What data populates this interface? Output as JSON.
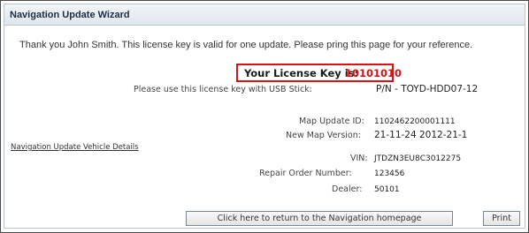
{
  "window": {
    "title": "Navigation Update Wizard"
  },
  "message": "Thank you John Smith.  This license key is valid for one update.  Please pring this page for your reference.",
  "license": {
    "label": "Your License Key is:",
    "key": "10101010",
    "usb_label": "Please use this license key with USB Stick:",
    "usb_value": "P/N - TOYD-HDD07-12"
  },
  "map": {
    "update_id_label": "Map Update ID:",
    "update_id_value": "1102462200001111",
    "version_label": "New Map Version:",
    "version_value": "21-11-24 2012-21-1"
  },
  "vehicle": {
    "details_link": "Navigation Update Vehicle Details",
    "vin_label": "VIN:",
    "vin_value": "JTDZN3EU8C3012275",
    "repair_order_label": "Repair Order Number:",
    "repair_order_value": "123456",
    "dealer_label": "Dealer:",
    "dealer_value": "50101"
  },
  "actions": {
    "home_label": "Click here to return to the Navigation homepage",
    "print_label": "Print"
  },
  "colors": {
    "accent_red": "#e01010",
    "titlebar_text": "#1d2d44"
  }
}
